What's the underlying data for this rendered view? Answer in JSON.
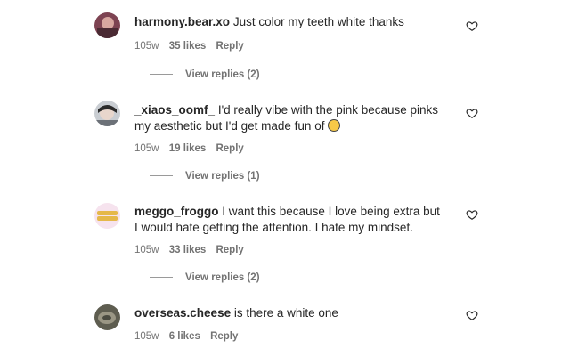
{
  "comments": [
    {
      "username": "harmony.bear.xo",
      "text": "Just color my teeth white thanks",
      "age": "105w",
      "likes": "35 likes",
      "reply": "Reply",
      "view_replies": "View replies (2)",
      "avatar_color": "#8a4a5a"
    },
    {
      "username": "_xiaos_oomf_",
      "text": "I'd really vibe with the pink because pinks my aesthetic but I'd get made fun of",
      "age": "105w",
      "likes": "19 likes",
      "reply": "Reply",
      "view_replies": "View replies (1)",
      "avatar_color": "#9aa0a6"
    },
    {
      "username": "meggo_froggo",
      "text": "I want this because I love being extra but I would hate getting the attention. I hate my mindset.",
      "age": "105w",
      "likes": "33 likes",
      "reply": "Reply",
      "view_replies": "View replies (2)",
      "avatar_color": "#f3d9e6"
    },
    {
      "username": "overseas.cheese",
      "text": "is there a white one",
      "age": "105w",
      "likes": "6 likes",
      "reply": "Reply",
      "avatar_color": "#6b6a5a"
    }
  ],
  "icons": {
    "like": "heart-outline-icon",
    "emoji": "grinning-sweat-emoji"
  }
}
